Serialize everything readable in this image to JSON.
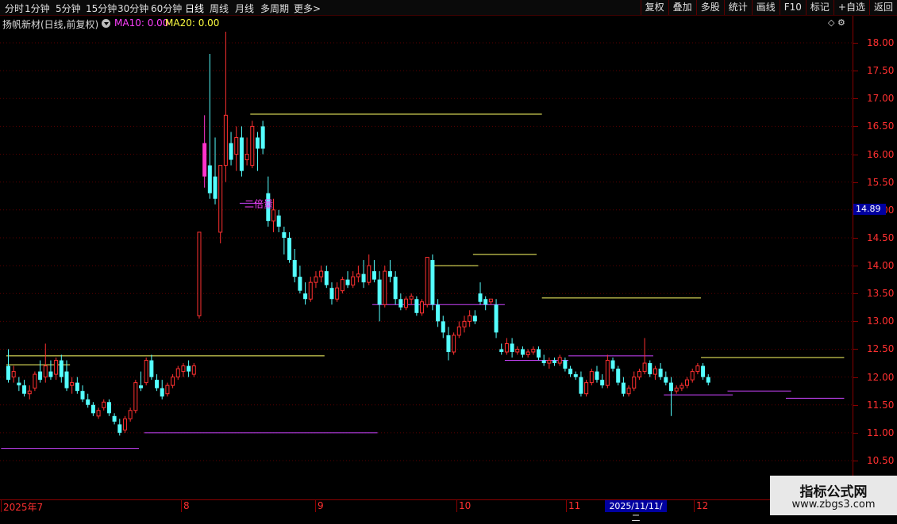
{
  "toolbar": {
    "periods": [
      "分时",
      "1分钟",
      "5分钟",
      "15分钟",
      "30分钟",
      "60分钟",
      "日线",
      "周线",
      "月线",
      "多周期",
      "更多>"
    ],
    "active_period": "日线",
    "tools": [
      "复权",
      "叠加",
      "多股",
      "统计",
      "画线",
      "F10",
      "标记",
      "+自选",
      "返回"
    ]
  },
  "info": {
    "stock_label": "扬帆新材(日线,前复权)",
    "ma10": "MA10: 0.00",
    "ma20": "MA20: 0.00",
    "corner_icons": "◇ ⚙"
  },
  "annotation": "二倍量",
  "current_price": "14.89",
  "crosshair_date": "2025/11/11/二",
  "y_axis": {
    "ticks": [
      "18.00",
      "17.50",
      "17.00",
      "16.50",
      "16.00",
      "15.50",
      "15.00",
      "14.50",
      "14.00",
      "13.50",
      "13.00",
      "12.50",
      "12.00",
      "11.50",
      "11.00",
      "10.50"
    ]
  },
  "x_axis": {
    "labels": [
      "2025年7",
      "8",
      "9",
      "10",
      "11",
      "12"
    ]
  },
  "watermark": {
    "title": "指标公式网",
    "url": "www.zbgs3.com"
  },
  "colors": {
    "up": "#ff3030",
    "down": "#54ffff",
    "yellow_line": "#ffff66",
    "purple_line": "#cc44ff",
    "highlight": "#ff33cc"
  },
  "chart_data": {
    "type": "candlestick",
    "ylim": [
      10.2,
      18.4
    ],
    "candles": [
      [
        12.2,
        12.5,
        11.9,
        11.95
      ],
      [
        12.0,
        12.2,
        11.9,
        12.1
      ],
      [
        11.9,
        12.0,
        11.75,
        11.85
      ],
      [
        11.85,
        11.95,
        11.65,
        11.7
      ],
      [
        11.7,
        11.85,
        11.6,
        11.75
      ],
      [
        11.8,
        12.1,
        11.75,
        12.05
      ],
      [
        12.1,
        12.3,
        11.9,
        11.95
      ],
      [
        12.0,
        12.6,
        11.9,
        12.2
      ],
      [
        12.1,
        12.3,
        11.95,
        12.0
      ],
      [
        12.05,
        12.35,
        11.95,
        12.3
      ],
      [
        12.3,
        12.4,
        11.9,
        12.0
      ],
      [
        12.1,
        12.3,
        11.75,
        11.8
      ],
      [
        11.85,
        12.0,
        11.7,
        11.9
      ],
      [
        11.9,
        12.0,
        11.7,
        11.75
      ],
      [
        11.75,
        11.85,
        11.55,
        11.6
      ],
      [
        11.6,
        11.7,
        11.45,
        11.5
      ],
      [
        11.5,
        11.55,
        11.3,
        11.35
      ],
      [
        11.3,
        11.45,
        11.25,
        11.4
      ],
      [
        11.45,
        11.6,
        11.4,
        11.55
      ],
      [
        11.55,
        11.6,
        11.3,
        11.35
      ],
      [
        11.3,
        11.35,
        11.15,
        11.2
      ],
      [
        11.15,
        11.25,
        10.95,
        11.0
      ],
      [
        11.05,
        11.3,
        11.0,
        11.25
      ],
      [
        11.25,
        11.45,
        11.2,
        11.4
      ],
      [
        11.4,
        11.95,
        11.35,
        11.9
      ],
      [
        11.85,
        12.1,
        11.75,
        11.8
      ],
      [
        11.9,
        12.35,
        11.85,
        12.3
      ],
      [
        12.3,
        12.4,
        11.95,
        12.0
      ],
      [
        11.95,
        12.05,
        11.75,
        11.8
      ],
      [
        11.8,
        11.95,
        11.6,
        11.65
      ],
      [
        11.7,
        11.9,
        11.65,
        11.85
      ],
      [
        11.85,
        12.05,
        11.8,
        12.0
      ],
      [
        12.0,
        12.2,
        11.95,
        12.15
      ],
      [
        12.1,
        12.25,
        12.0,
        12.2
      ],
      [
        12.2,
        12.3,
        12.0,
        12.1
      ],
      [
        12.05,
        12.25,
        12.0,
        12.2
      ],
      [
        13.1,
        14.6,
        13.05,
        14.6
      ],
      [
        16.2,
        16.7,
        15.4,
        15.6
      ],
      [
        15.8,
        17.8,
        15.2,
        15.3
      ],
      [
        15.6,
        16.3,
        15.1,
        15.2
      ],
      [
        14.6,
        15.6,
        14.4,
        15.8
      ],
      [
        15.8,
        18.2,
        15.5,
        16.7
      ],
      [
        16.2,
        16.4,
        15.8,
        15.9
      ],
      [
        16.0,
        16.5,
        15.7,
        16.3
      ],
      [
        16.3,
        16.5,
        15.6,
        15.7
      ],
      [
        15.9,
        16.3,
        15.8,
        16.0
      ],
      [
        15.8,
        16.6,
        15.75,
        16.5
      ],
      [
        16.3,
        16.4,
        15.7,
        16.1
      ],
      [
        16.5,
        16.6,
        16.0,
        16.1
      ],
      [
        15.3,
        15.6,
        14.7,
        14.8
      ],
      [
        14.8,
        15.2,
        14.6,
        15.0
      ],
      [
        14.9,
        15.0,
        14.6,
        14.7
      ],
      [
        14.6,
        14.7,
        14.2,
        14.5
      ],
      [
        14.5,
        14.6,
        14.05,
        14.1
      ],
      [
        14.1,
        14.3,
        13.7,
        13.8
      ],
      [
        13.8,
        14.0,
        13.5,
        13.55
      ],
      [
        13.5,
        13.7,
        13.3,
        13.4
      ],
      [
        13.4,
        13.8,
        13.35,
        13.7
      ],
      [
        13.7,
        13.9,
        13.6,
        13.8
      ],
      [
        13.8,
        14.0,
        13.7,
        13.9
      ],
      [
        13.9,
        14.0,
        13.6,
        13.65
      ],
      [
        13.6,
        13.7,
        13.3,
        13.4
      ],
      [
        13.4,
        13.7,
        13.35,
        13.6
      ],
      [
        13.55,
        13.8,
        13.5,
        13.75
      ],
      [
        13.75,
        13.9,
        13.6,
        13.65
      ],
      [
        13.65,
        13.9,
        13.6,
        13.8
      ],
      [
        13.8,
        14.0,
        13.7,
        13.85
      ],
      [
        13.85,
        14.1,
        13.6,
        13.7
      ],
      [
        13.7,
        14.2,
        13.65,
        14.0
      ],
      [
        13.9,
        14.1,
        13.7,
        13.75
      ],
      [
        13.75,
        13.9,
        13.0,
        13.3
      ],
      [
        13.3,
        14.0,
        13.25,
        13.9
      ],
      [
        13.9,
        14.1,
        13.7,
        13.8
      ],
      [
        13.8,
        13.9,
        13.3,
        13.4
      ],
      [
        13.4,
        13.5,
        13.2,
        13.25
      ],
      [
        13.25,
        13.45,
        13.2,
        13.4
      ],
      [
        13.4,
        13.5,
        13.3,
        13.45
      ],
      [
        13.4,
        13.45,
        13.1,
        13.15
      ],
      [
        13.15,
        13.4,
        13.1,
        13.35
      ],
      [
        13.3,
        14.1,
        13.25,
        14.15
      ],
      [
        14.1,
        14.2,
        13.2,
        13.3
      ],
      [
        13.3,
        13.4,
        12.9,
        13.0
      ],
      [
        13.0,
        13.1,
        12.7,
        12.8
      ],
      [
        12.75,
        12.9,
        12.3,
        12.45
      ],
      [
        12.45,
        12.8,
        12.4,
        12.75
      ],
      [
        12.75,
        13.0,
        12.7,
        12.9
      ],
      [
        12.9,
        13.1,
        12.8,
        13.0
      ],
      [
        13.0,
        13.2,
        12.9,
        13.1
      ],
      [
        13.1,
        13.2,
        12.95,
        13.0
      ],
      [
        13.5,
        13.7,
        13.3,
        13.35
      ],
      [
        13.4,
        13.45,
        13.2,
        13.3
      ],
      [
        13.35,
        13.4,
        13.3,
        13.4
      ],
      [
        13.3,
        13.4,
        12.7,
        12.8
      ],
      [
        12.5,
        12.6,
        12.4,
        12.45
      ],
      [
        12.45,
        12.7,
        12.4,
        12.6
      ],
      [
        12.6,
        12.7,
        12.35,
        12.45
      ],
      [
        12.45,
        12.55,
        12.4,
        12.5
      ],
      [
        12.5,
        12.55,
        12.35,
        12.4
      ],
      [
        12.4,
        12.5,
        12.35,
        12.45
      ],
      [
        12.45,
        12.55,
        12.4,
        12.5
      ],
      [
        12.5,
        12.55,
        12.3,
        12.35
      ],
      [
        12.3,
        12.4,
        12.2,
        12.25
      ],
      [
        12.25,
        12.35,
        12.15,
        12.3
      ],
      [
        12.3,
        12.35,
        12.2,
        12.25
      ],
      [
        12.25,
        12.4,
        12.2,
        12.35
      ],
      [
        12.3,
        12.35,
        12.1,
        12.15
      ],
      [
        12.15,
        12.2,
        12.0,
        12.05
      ],
      [
        12.05,
        12.1,
        11.95,
        12.0
      ],
      [
        12.0,
        12.1,
        11.65,
        11.7
      ],
      [
        11.7,
        11.95,
        11.65,
        11.9
      ],
      [
        11.9,
        12.15,
        11.85,
        12.1
      ],
      [
        12.1,
        12.2,
        11.9,
        11.95
      ],
      [
        11.95,
        12.05,
        11.8,
        11.85
      ],
      [
        11.85,
        12.4,
        11.8,
        12.3
      ],
      [
        12.3,
        12.35,
        12.1,
        12.15
      ],
      [
        12.15,
        12.2,
        11.85,
        11.9
      ],
      [
        11.9,
        12.0,
        11.65,
        11.7
      ],
      [
        11.7,
        11.85,
        11.65,
        11.8
      ],
      [
        11.8,
        12.1,
        11.75,
        12.0
      ],
      [
        12.0,
        12.15,
        11.95,
        12.1
      ],
      [
        12.1,
        12.7,
        12.05,
        12.25
      ],
      [
        12.25,
        12.3,
        12.0,
        12.05
      ],
      [
        12.05,
        12.2,
        11.95,
        12.15
      ],
      [
        12.15,
        12.25,
        11.95,
        12.0
      ],
      [
        12.0,
        12.1,
        11.85,
        11.9
      ],
      [
        11.9,
        12.0,
        11.3,
        11.75
      ],
      [
        11.75,
        11.85,
        11.7,
        11.8
      ],
      [
        11.8,
        11.9,
        11.75,
        11.85
      ],
      [
        11.85,
        12.0,
        11.8,
        11.95
      ],
      [
        11.95,
        12.15,
        11.9,
        12.1
      ],
      [
        12.1,
        12.25,
        12.05,
        12.2
      ],
      [
        12.2,
        12.25,
        11.95,
        12.0
      ],
      [
        12.0,
        12.05,
        11.85,
        11.9
      ]
    ],
    "highlight_index": 37,
    "hlines": [
      {
        "y": 12.38,
        "from": 0,
        "to": 60,
        "color": "yellow"
      },
      {
        "y": 12.22,
        "from": 0,
        "to": 12,
        "color": "yellow"
      },
      {
        "y": 11.0,
        "from": 26,
        "to": 70,
        "color": "purple"
      },
      {
        "y": 10.72,
        "from": -1,
        "to": 25,
        "color": "purple"
      },
      {
        "y": 16.72,
        "from": 46,
        "to": 101,
        "color": "yellow"
      },
      {
        "y": 15.12,
        "from": 44,
        "to": 48,
        "color": "purple"
      },
      {
        "y": 14.0,
        "from": 80,
        "to": 89,
        "color": "yellow"
      },
      {
        "y": 14.2,
        "from": 88,
        "to": 100,
        "color": "yellow"
      },
      {
        "y": 13.3,
        "from": 69,
        "to": 94,
        "color": "purple"
      },
      {
        "y": 12.3,
        "from": 94,
        "to": 106,
        "color": "purple"
      },
      {
        "y": 13.42,
        "from": 101,
        "to": 131,
        "color": "yellow"
      },
      {
        "y": 12.38,
        "from": 106,
        "to": 122,
        "color": "purple"
      },
      {
        "y": 12.35,
        "from": 131,
        "to": 158,
        "color": "yellow"
      },
      {
        "y": 11.68,
        "from": 124,
        "to": 137,
        "color": "purple"
      },
      {
        "y": 11.75,
        "from": 136,
        "to": 148,
        "color": "purple"
      },
      {
        "y": 11.62,
        "from": 147,
        "to": 158,
        "color": "purple"
      }
    ]
  }
}
